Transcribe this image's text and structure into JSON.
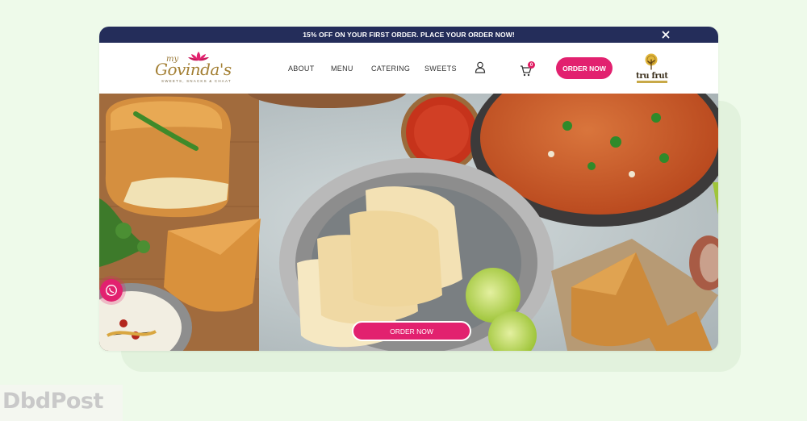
{
  "promo": {
    "text": "15% OFF ON YOUR FIRST ORDER. PLACE YOUR ORDER NOW!"
  },
  "logo": {
    "my": "my",
    "name": "Govinda's",
    "tagline": "SWEETS, SNACKS & CHAAT"
  },
  "nav": {
    "items": [
      {
        "label": "ABOUT"
      },
      {
        "label": "MENU"
      },
      {
        "label": "CATERING"
      },
      {
        "label": "SWEETS"
      }
    ],
    "cart_count": "0",
    "order_button": "ORDER NOW"
  },
  "partner": {
    "name": "tru frut"
  },
  "hero": {
    "order_button": "ORDER NOW"
  },
  "watermark": {
    "brand": "DbdPost"
  },
  "colors": {
    "accent": "#e2216f",
    "promo_bg": "#242d5a",
    "logo_gold": "#a48035"
  },
  "icons": [
    "close-icon",
    "lotus-icon",
    "user-icon",
    "cart-icon",
    "whatsapp-icon",
    "tree-icon"
  ]
}
